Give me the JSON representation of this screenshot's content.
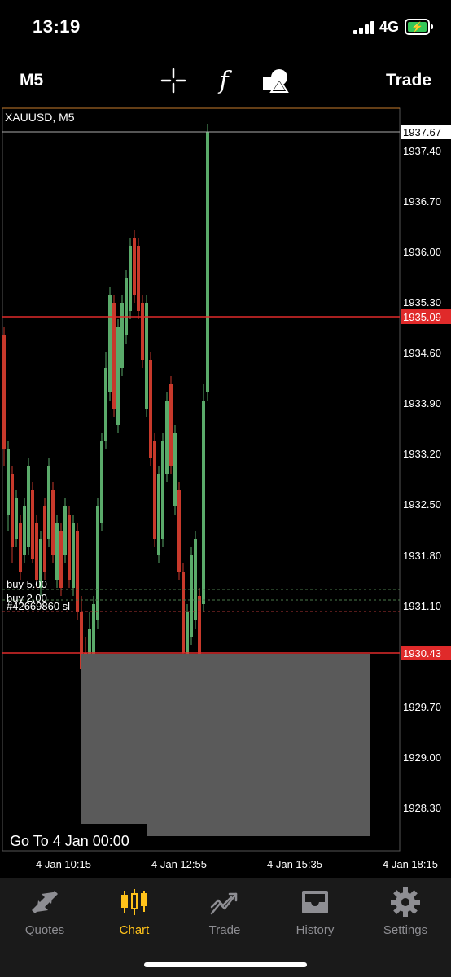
{
  "status_bar": {
    "time": "13:19",
    "network": "4G"
  },
  "toolbar": {
    "timeframe": "M5",
    "trade_label": "Trade",
    "tools": [
      "crosshair-icon",
      "indicators-icon",
      "objects-icon"
    ],
    "function_glyph": "f"
  },
  "chart": {
    "symbol_title": "XAUUSD, M5",
    "price_labels": [
      "1937.40",
      "1936.70",
      "1936.00",
      "1935.30",
      "1934.60",
      "1933.90",
      "1933.20",
      "1932.50",
      "1931.80",
      "1931.10",
      "1929.70",
      "1929.00",
      "1928.30"
    ],
    "current_ask": "1937.67",
    "bid_line": "1935.09",
    "sl_line": "1930.43",
    "trade_lines": [
      "buy 5.00",
      "buy 2.00",
      "#42669860 sl"
    ],
    "time_labels": [
      "4 Jan 10:15",
      "4 Jan 12:55",
      "4 Jan 15:35",
      "4 Jan 18:15"
    ],
    "goto_label": "Go To 4 Jan 00:00",
    "colors": {
      "bull": "#5aaa6a",
      "bear": "#c8392b",
      "level_line": "#e02a2a",
      "gap_fill": "#5a5a5a",
      "accent": "#ffc21a"
    }
  },
  "tabbar": {
    "tabs": [
      {
        "label": "Quotes",
        "icon": "quotes-icon",
        "active": false
      },
      {
        "label": "Chart",
        "icon": "chart-icon",
        "active": true
      },
      {
        "label": "Trade",
        "icon": "trade-icon",
        "active": false
      },
      {
        "label": "History",
        "icon": "history-icon",
        "active": false
      },
      {
        "label": "Settings",
        "icon": "settings-icon",
        "active": false
      }
    ]
  }
}
